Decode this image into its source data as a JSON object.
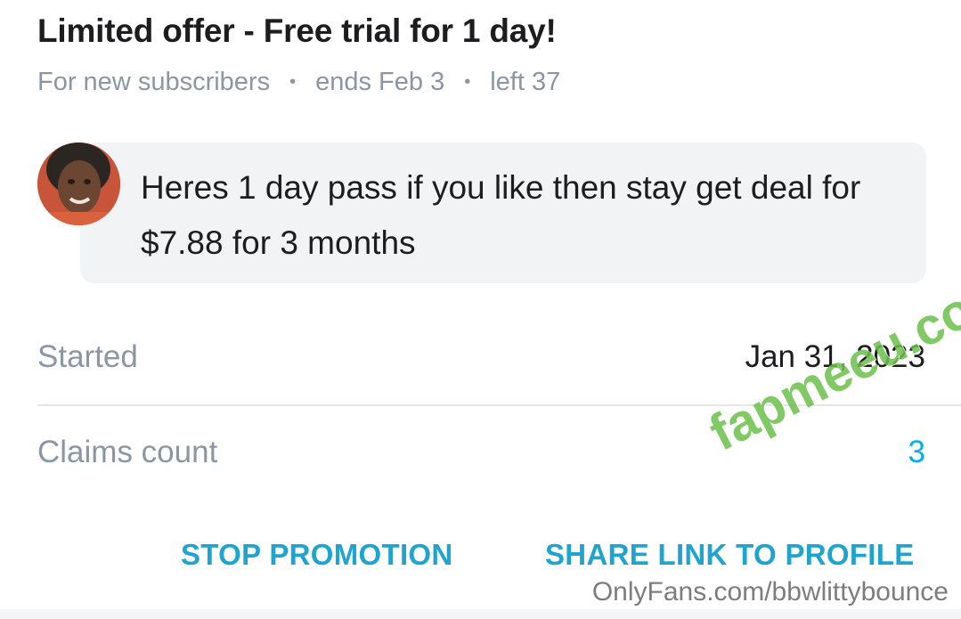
{
  "offer": {
    "title": "Limited offer - Free trial for 1 day!",
    "audience": "For new subscribers",
    "ends": "ends Feb 3",
    "left": "left 37",
    "separator": "•"
  },
  "message": {
    "avatar_icon": "user-avatar",
    "text": "Heres 1 day pass if you like then stay get deal for $7.88 for 3 months"
  },
  "details": {
    "started_label": "Started",
    "started_value": "Jan 31, 2023",
    "claims_label": "Claims count",
    "claims_value": "3"
  },
  "actions": {
    "stop_label": "STOP PROMOTION",
    "share_label": "SHARE LINK TO PROFILE"
  },
  "overlay": {
    "watermark": "fapmeeu.com",
    "source": "OnlyFans.com/bbwlittybounce"
  },
  "colors": {
    "accent": "#00aff0",
    "action_text": "#1fa3cf",
    "muted_text": "#8a96a3",
    "watermark": "#6cc04a"
  }
}
